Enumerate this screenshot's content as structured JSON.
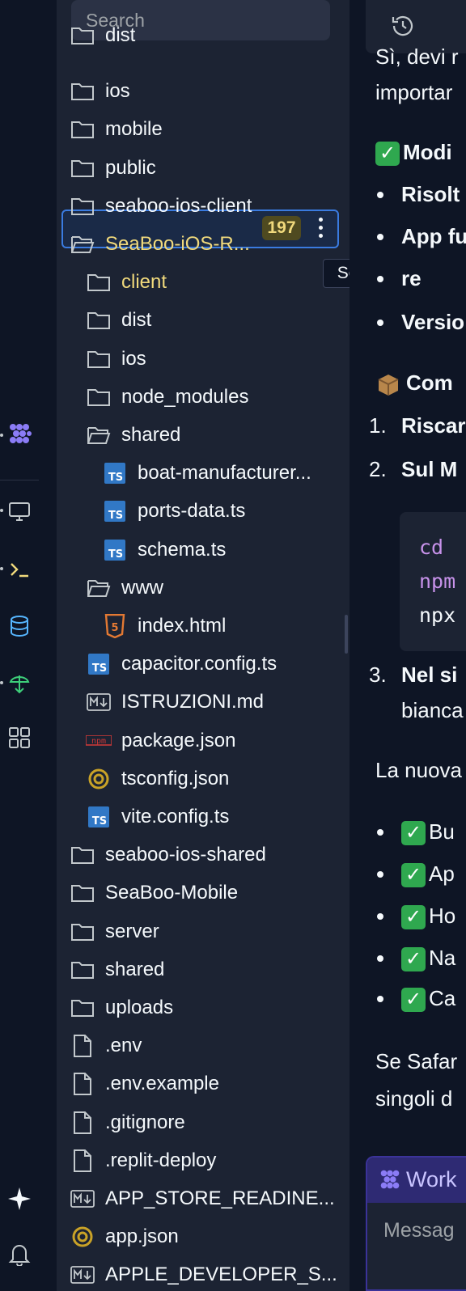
{
  "search": {
    "placeholder": "Search"
  },
  "tree": [
    {
      "label": "dist",
      "type": "folder",
      "indent": 0,
      "open": false
    },
    {
      "label": "ios",
      "type": "folder",
      "indent": 0,
      "open": false
    },
    {
      "label": "mobile",
      "type": "folder",
      "indent": 0,
      "open": false
    },
    {
      "label": "public",
      "type": "folder",
      "indent": 0,
      "open": false
    },
    {
      "label": "seaboo-ios-client",
      "type": "folder",
      "indent": 0,
      "open": false
    },
    {
      "label": "SeaBoo-iOS-R...",
      "type": "folder",
      "indent": 0,
      "open": true,
      "selected": true,
      "modified": true
    },
    {
      "label": "client",
      "type": "folder",
      "indent": 1,
      "open": false,
      "modified": true
    },
    {
      "label": "dist",
      "type": "folder",
      "indent": 1,
      "open": false
    },
    {
      "label": "ios",
      "type": "folder",
      "indent": 1,
      "open": false
    },
    {
      "label": "node_modules",
      "type": "folder",
      "indent": 1,
      "open": false
    },
    {
      "label": "shared",
      "type": "folder",
      "indent": 1,
      "open": true
    },
    {
      "label": "boat-manufacturer...",
      "type": "ts",
      "indent": 2
    },
    {
      "label": "ports-data.ts",
      "type": "ts",
      "indent": 2
    },
    {
      "label": "schema.ts",
      "type": "ts",
      "indent": 2
    },
    {
      "label": "www",
      "type": "folder",
      "indent": 1,
      "open": true
    },
    {
      "label": "index.html",
      "type": "html",
      "indent": 2
    },
    {
      "label": "capacitor.config.ts",
      "type": "ts",
      "indent": 1
    },
    {
      "label": "ISTRUZIONI.md",
      "type": "md",
      "indent": 1
    },
    {
      "label": "package.json",
      "type": "npm",
      "indent": 1
    },
    {
      "label": "tsconfig.json",
      "type": "json",
      "indent": 1
    },
    {
      "label": "vite.config.ts",
      "type": "ts",
      "indent": 1
    },
    {
      "label": "seaboo-ios-shared",
      "type": "folder",
      "indent": 0,
      "open": false
    },
    {
      "label": "SeaBoo-Mobile",
      "type": "folder",
      "indent": 0,
      "open": false
    },
    {
      "label": "server",
      "type": "folder",
      "indent": 0,
      "open": false
    },
    {
      "label": "shared",
      "type": "folder",
      "indent": 0,
      "open": false
    },
    {
      "label": "uploads",
      "type": "folder",
      "indent": 0,
      "open": false
    },
    {
      "label": ".env",
      "type": "file",
      "indent": 0
    },
    {
      "label": ".env.example",
      "type": "file",
      "indent": 0
    },
    {
      "label": ".gitignore",
      "type": "file",
      "indent": 0
    },
    {
      "label": ".replit-deploy",
      "type": "file",
      "indent": 0
    },
    {
      "label": "APP_STORE_READINE...",
      "type": "md",
      "indent": 0
    },
    {
      "label": "app.json",
      "type": "json",
      "indent": 0
    },
    {
      "label": "APPLE_DEVELOPER_S...",
      "type": "md",
      "indent": 0
    }
  ],
  "selected_badge": "197",
  "tooltip": "SeaBoo-iOS-Ready",
  "chat": {
    "lines": [
      {
        "text": "Sì, devi r",
        "bold": false
      },
      {
        "text": "importar",
        "bold": false
      },
      {
        "text": "Modi",
        "bold": true,
        "check": true
      },
      {
        "text": "Risolt",
        "bold": true,
        "bullet": true
      },
      {
        "text": "App fu",
        "bold": true,
        "bullet": true
      },
      {
        "text": "re",
        "bold": true,
        "bullet": true
      },
      {
        "text": "Versio",
        "bold": true,
        "bullet": true
      },
      {
        "text": "Com",
        "bold": true,
        "box": true
      },
      {
        "text": "Riscar",
        "bold": true,
        "num": "1."
      },
      {
        "text": "Sul M",
        "bold": true,
        "num": "2."
      },
      {
        "text": "Nel si",
        "bold": true,
        "num": "3."
      },
      {
        "text": "bianca",
        "bold": false
      },
      {
        "text": "La nuova",
        "bold": false
      },
      {
        "text": "Bu",
        "bold": false,
        "bullet": true,
        "check": true
      },
      {
        "text": "Ap",
        "bold": false,
        "bullet": true,
        "check": true
      },
      {
        "text": "Ho",
        "bold": false,
        "bullet": true,
        "check": true
      },
      {
        "text": "Na",
        "bold": false,
        "bullet": true,
        "check": true
      },
      {
        "text": "Ca",
        "bold": false,
        "bullet": true,
        "check": true
      },
      {
        "text": "Se Safar",
        "bold": false
      },
      {
        "text": "singoli d",
        "bold": false
      }
    ],
    "code": [
      "cd",
      "npm",
      "npx"
    ],
    "workflow_title": "Work",
    "message_placeholder": "Messag"
  },
  "colors": {
    "background": "#0e1525",
    "panel": "#1c2333",
    "selected_border": "#3a7be0",
    "modified_text": "#f0d97c",
    "ts_icon": "#3178c6",
    "check_green": "#2fa84f",
    "workflow_accent": "#6c5dd3"
  },
  "activity_icons": [
    "agent-icon",
    "monitor-icon",
    "terminal-icon",
    "database-icon",
    "deploy-icon",
    "apps-grid-icon",
    "sparkle-icon",
    "bell-icon"
  ]
}
